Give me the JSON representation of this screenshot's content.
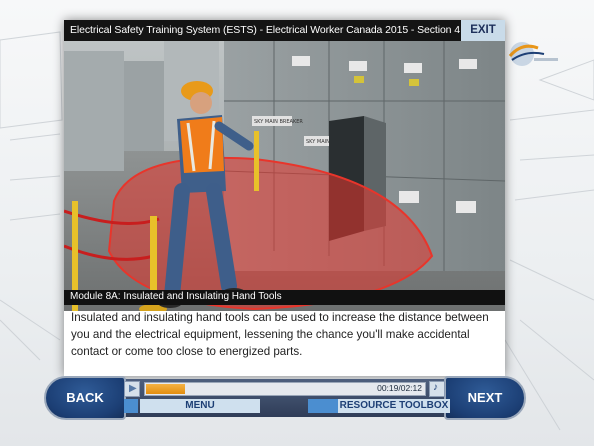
{
  "window": {
    "title": "Electrical Safety Training System (ESTS) - Electrical Worker Canada 2015 - Section 4",
    "exit_label": "EXIT"
  },
  "scene": {
    "breaker_label_left": "SKY MAIN BREAKER",
    "breaker_label_right": "SKY MAIN BREAKER"
  },
  "module": {
    "label": "Module 8A: Insulated and Insulating Hand Tools",
    "narration": "Insulated and insulating hand tools can be used to increase the distance between you and the electrical equipment, lessening the chance you'll make accidental contact or come too close to energized parts."
  },
  "player": {
    "back_label": "BACK",
    "next_label": "NEXT",
    "menu_label": "MENU",
    "toolbox_label": "RESOURCE TOOLBOX",
    "time": "00:19/02:12",
    "progress": 0.14
  },
  "colors": {
    "accent_blue": "#1d3f75",
    "progress_orange": "#e8961a",
    "hazard_red": "#e8352b"
  },
  "icons": {
    "play": "play-icon",
    "volume": "volume-icon",
    "logo": "globe-logo-icon"
  }
}
